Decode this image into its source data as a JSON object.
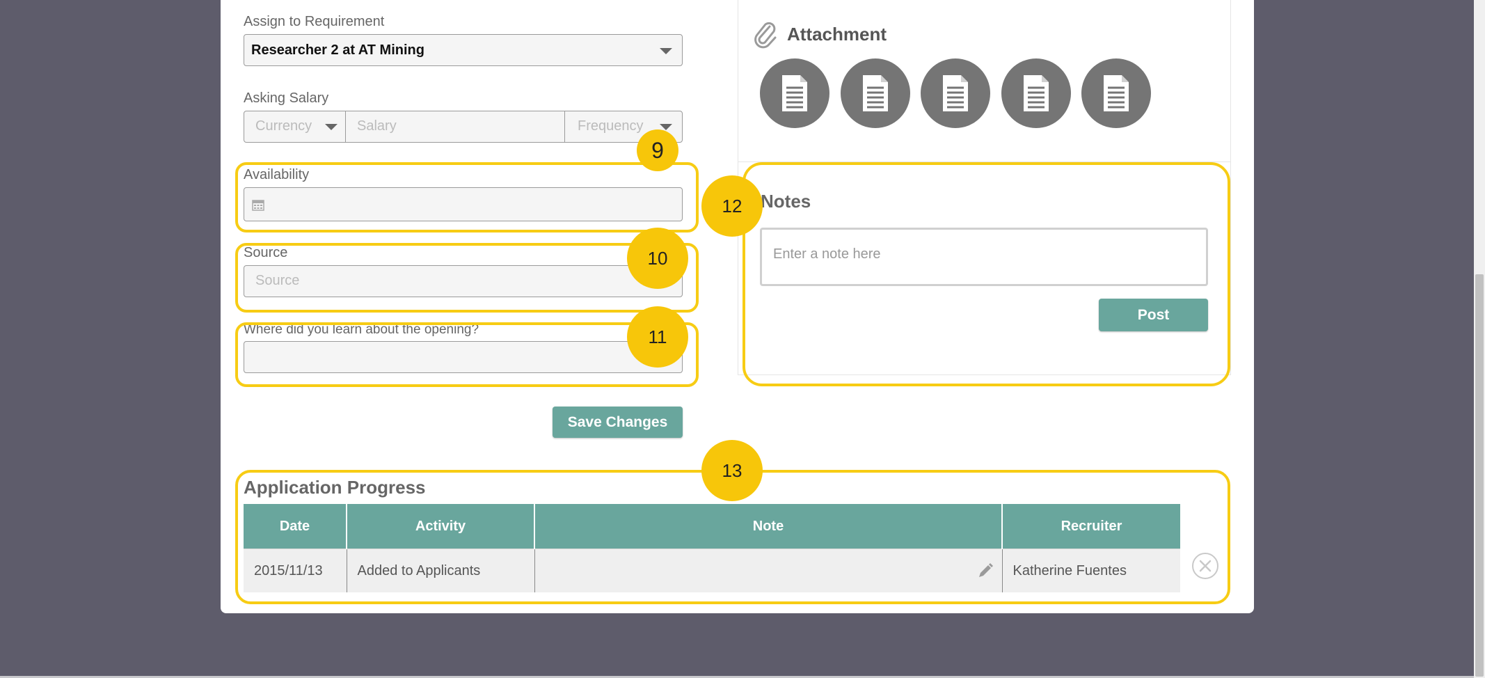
{
  "form": {
    "requirement_label": "Assign to Requirement",
    "requirement_value": "Researcher 2 at AT Mining",
    "salary_label": "Asking Salary",
    "currency_placeholder": "Currency",
    "salary_placeholder": "Salary",
    "frequency_placeholder": "Frequency",
    "availability_label": "Availability",
    "availability_value": "",
    "source_label": "Source",
    "source_placeholder": "Source",
    "learn_label": "Where did you learn about the opening?",
    "learn_value": "",
    "save_button": "Save Changes"
  },
  "attachment": {
    "title": "Attachment",
    "icon": "paperclip-icon",
    "files": [
      "document-icon",
      "document-icon",
      "document-icon",
      "document-icon",
      "document-icon"
    ]
  },
  "notes": {
    "title": "Notes",
    "placeholder": "Enter a note here",
    "post_button": "Post"
  },
  "progress": {
    "title": "Application Progress",
    "columns": [
      "Date",
      "Activity",
      "Note",
      "Recruiter"
    ],
    "rows": [
      {
        "date": "2015/11/13",
        "activity": "Added to Applicants",
        "note": "",
        "recruiter": "Katherine Fuentes"
      }
    ]
  },
  "annotations": {
    "b9": "9",
    "b10": "10",
    "b11": "11",
    "b12": "12",
    "b13": "13",
    "color": "#f7cc14"
  },
  "colors": {
    "accent": "#69a69d",
    "backdrop": "#5e5c6b"
  }
}
